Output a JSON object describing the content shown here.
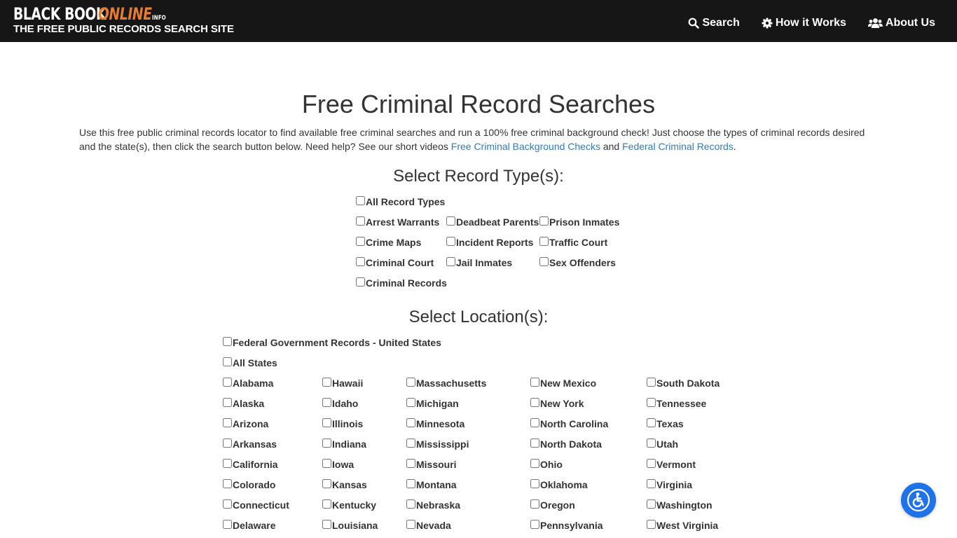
{
  "header": {
    "logo_black": "BLACK BOOK",
    "logo_online": "ONLINE",
    "logo_info": "INFO",
    "tagline": "THE FREE PUBLIC RECORDS SEARCH SITE",
    "nav": [
      {
        "label": "Search",
        "icon": "search-icon"
      },
      {
        "label": "How it Works",
        "icon": "gear-icon"
      },
      {
        "label": "About Us",
        "icon": "users-icon"
      }
    ]
  },
  "main": {
    "title": "Free Criminal Record Searches",
    "intro_text": "Use this free public criminal records locator to find available free criminal searches and run a 100% free criminal background check! Just choose the types of criminal records desired and the state(s), then click the search button below. Need help? See our short videos ",
    "intro_link1": "Free Criminal Background Checks",
    "intro_and": " and ",
    "intro_link2": "Federal Criminal Records",
    "intro_end": ".",
    "record_types_heading": "Select Record Type(s):",
    "record_types": {
      "all": "All Record Types",
      "col1": [
        "Arrest Warrants",
        "Crime Maps",
        "Criminal Court",
        "Criminal Records"
      ],
      "col2": [
        "Deadbeat Parents",
        "Incident Reports",
        "Jail Inmates"
      ],
      "col3": [
        "Prison Inmates",
        "Traffic Court",
        "Sex Offenders"
      ]
    },
    "locations_heading": "Select Location(s):",
    "locations": {
      "federal": "Federal Government Records - United States",
      "all": "All States",
      "columns": [
        [
          "Alabama",
          "Alaska",
          "Arizona",
          "Arkansas",
          "California",
          "Colorado",
          "Connecticut",
          "Delaware"
        ],
        [
          "Hawaii",
          "Idaho",
          "Illinois",
          "Indiana",
          "Iowa",
          "Kansas",
          "Kentucky",
          "Louisiana"
        ],
        [
          "Massachusetts",
          "Michigan",
          "Minnesota",
          "Mississippi",
          "Missouri",
          "Montana",
          "Nebraska",
          "Nevada"
        ],
        [
          "New Mexico",
          "New York",
          "North Carolina",
          "North Dakota",
          "Ohio",
          "Oklahoma",
          "Oregon",
          "Pennsylvania"
        ],
        [
          "South Dakota",
          "Tennessee",
          "Texas",
          "Utah",
          "Vermont",
          "Virginia",
          "Washington",
          "West Virginia"
        ]
      ]
    }
  },
  "accessibility": {
    "icon": "accessibility-icon"
  },
  "colors": {
    "header_bg": "#161616",
    "logo_accent": "#e97a2f",
    "link": "#337ab7",
    "a11y_button": "#1e73e8"
  }
}
